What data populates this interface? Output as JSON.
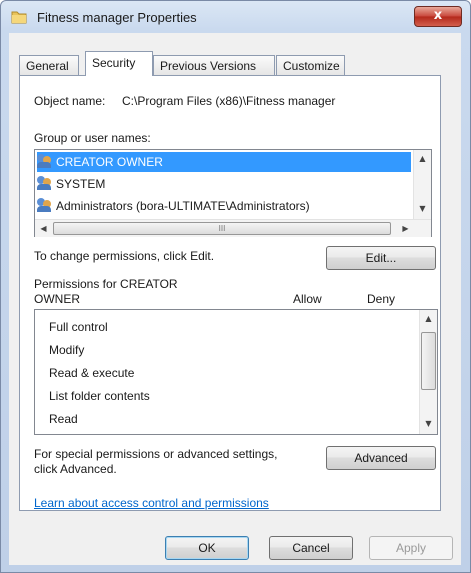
{
  "window": {
    "title": "Fitness manager Properties",
    "close_glyph": "x",
    "colors": {
      "selection": "#3399ff",
      "link": "#0066cc",
      "close": "#c8463a"
    }
  },
  "tabs": [
    "General",
    "Security",
    "Previous Versions",
    "Customize"
  ],
  "active_tab": "Security",
  "object": {
    "label": "Object name:",
    "value": "C:\\Program Files (x86)\\Fitness manager"
  },
  "groups": {
    "label": "Group or user names:",
    "items": [
      {
        "name": "CREATOR OWNER",
        "icon": "users-icon",
        "selected": true
      },
      {
        "name": "SYSTEM",
        "icon": "users-icon",
        "selected": false
      },
      {
        "name": "Administrators (bora-ULTIMATE\\Administrators)",
        "icon": "users-icon",
        "selected": false
      }
    ],
    "hscroll_grip": "III"
  },
  "change": {
    "text": "To change permissions, click Edit.",
    "edit_button": "Edit..."
  },
  "permissions": {
    "header_line1": "Permissions for CREATOR",
    "header_line2": "OWNER",
    "allow_label": "Allow",
    "deny_label": "Deny",
    "rows": [
      "Full control",
      "Modify",
      "Read & execute",
      "List folder contents",
      "Read"
    ]
  },
  "special": {
    "line1": "For special permissions or advanced settings,",
    "line2": "click Advanced.",
    "advanced_button": "Advanced"
  },
  "learn_link": "Learn about access control and permissions",
  "footer": {
    "ok": "OK",
    "cancel": "Cancel",
    "apply": "Apply"
  }
}
